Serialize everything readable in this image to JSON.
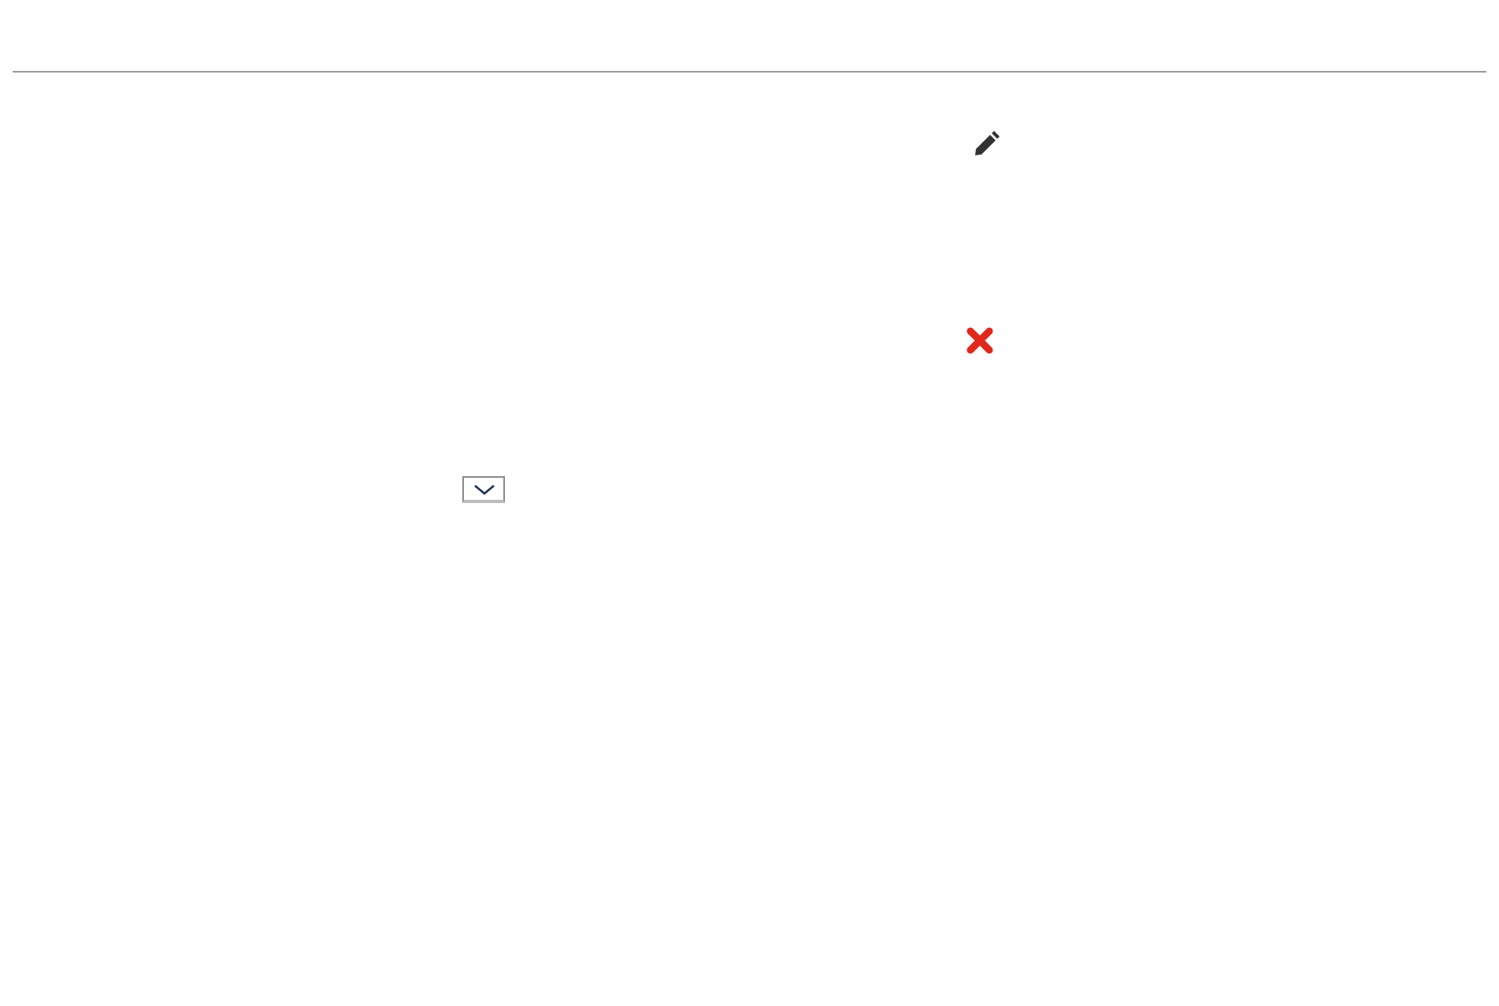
{
  "row_actions": [
    {
      "kind": "edit"
    },
    {
      "kind": "delete"
    }
  ],
  "dropdown": {
    "expanded": false
  }
}
